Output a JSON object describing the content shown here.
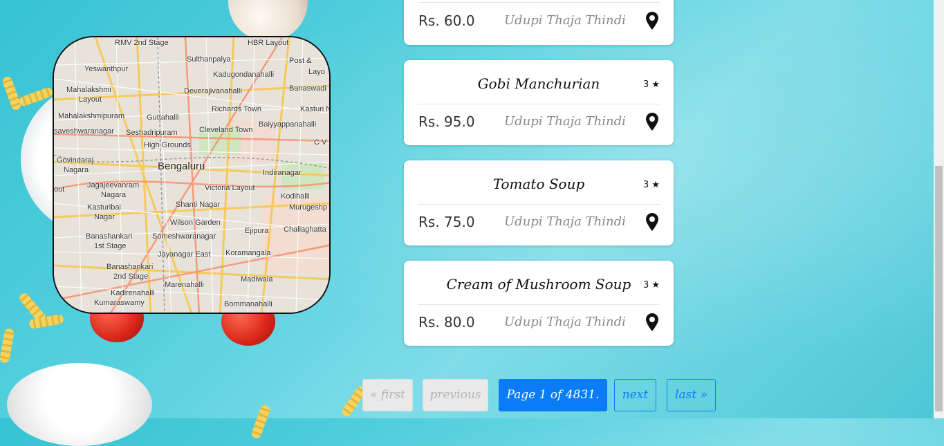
{
  "map": {
    "labels": [
      "RMV 2nd Stage",
      "HBR Layout",
      "Post &",
      "Layo",
      "Yeswanthpur",
      "Sulthanpalya",
      "Kadugondanahalli",
      "Banaswadi",
      "Mahalakshmi",
      "Layout",
      "Deverajivanahalli",
      "Kasturi N",
      "Mahalakshmipuram",
      "Guttahalli",
      "Richards Town",
      "saveshwaranagar",
      "Seshadripuram",
      "Baiyyappanahalli",
      "Cleveland Town",
      "C V R",
      "High Grounds",
      "Govindaraj",
      "Nagara",
      "Bengaluru",
      "Indiranagar",
      "out",
      "Jagajeevanram",
      "Nagara",
      "Victoria Layout",
      "Kodihalli",
      "Kasturibai",
      "Nagar",
      "Shanti Nagar",
      "Murugeshp",
      "Wilson Garden",
      "Ejipura",
      "Challaghatta",
      "Banashankari",
      "1st Stage",
      "Someshwaranagar",
      "Jayanagar East",
      "Koramangala",
      "Banashankari",
      "2nd Stage",
      "Marenahalli",
      "Madiwala",
      "Kadirenahalli",
      "Kumaraswamy",
      "Bommanahalli"
    ]
  },
  "cards": [
    {
      "name": "",
      "rating": "",
      "price": "Rs. 60.0",
      "restaurant": "Udupi Thaja Thindi"
    },
    {
      "name": "Gobi Manchurian",
      "rating": "3 ★",
      "price": "Rs. 95.0",
      "restaurant": "Udupi Thaja Thindi"
    },
    {
      "name": "Tomato Soup",
      "rating": "3 ★",
      "price": "Rs. 75.0",
      "restaurant": "Udupi Thaja Thindi"
    },
    {
      "name": "Cream of Mushroom Soup",
      "rating": "3 ★",
      "price": "Rs. 80.0",
      "restaurant": "Udupi Thaja Thindi"
    }
  ],
  "pagination": {
    "first": "« first",
    "previous": "previous",
    "current": "Page 1 of 4831.",
    "next": "next",
    "last": "last »"
  },
  "icons": {
    "location": "map-pin-icon",
    "star": "star-icon"
  },
  "colors": {
    "background": "#4cc7d6",
    "active_page": "#0a7cf5",
    "card": "#ffffff"
  }
}
